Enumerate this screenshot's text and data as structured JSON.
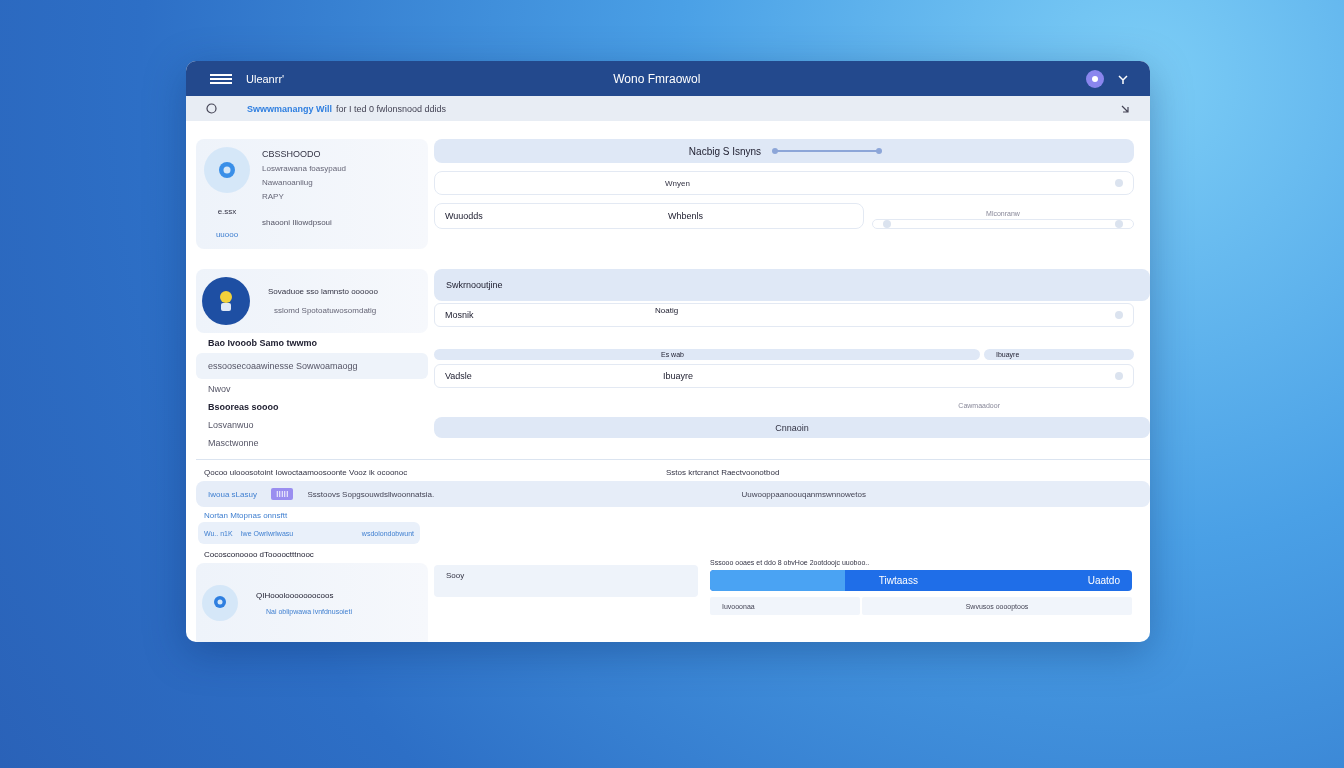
{
  "titlebar": {
    "app_label": "Uleanrr'",
    "title": "Wono Fmraowol"
  },
  "breadcrumb": {
    "link": "Swwwmanangy Will",
    "text": "for I ted 0 fwlonsnood ddids"
  },
  "profile": {
    "name": "CBSSHOODO",
    "lines": [
      "Loswrawana foasypaud",
      "Nawanoaniiug",
      "RAPY"
    ],
    "side_labels": [
      "e.ssx",
      "uuooo"
    ],
    "note": "shaooni Iliowdpsoui"
  },
  "settings": {
    "title": "Nacbig S Isnyns",
    "row_label": "Wnyen",
    "left_label": "Wuuodds",
    "left_value": "Whbenls",
    "right_caption": "Mlconranw",
    "level": 1
  },
  "account": {
    "title": "Swkrnooutjine",
    "subtitle": "Sovaduoe sso lamnsto oooooo",
    "line": "sslomd Spotoatuwosomdatig",
    "field_label": "Mosnik",
    "field_value": "Noatig"
  },
  "menu": [
    {
      "label": "Bao Ivooob Samo twwmo",
      "kind": "heading",
      "selected": false
    },
    {
      "label": "essoosecoaawinesse Sowwoamaogg",
      "kind": "plain",
      "selected": true
    },
    {
      "label": "Nwov",
      "kind": "plain",
      "selected": false
    },
    {
      "label": "Bsooreas soooo",
      "kind": "heading",
      "selected": false
    },
    {
      "label": "Losvanwuo",
      "kind": "plain",
      "selected": false
    },
    {
      "label": "Masctwonne",
      "kind": "plain",
      "selected": false
    }
  ],
  "table": {
    "columns": [
      "Es wab",
      "Ibuayre"
    ],
    "row": [
      "Vadsle",
      "Ibuayre"
    ],
    "caption": "Cawmaadoor",
    "footer": "Cnnaoin"
  },
  "summary": {
    "left_heading": "Qocoo ulooosotoint Iowoctaamoosoonte Vooz ik ocoonoc",
    "right_heading": "Sstos krtcranct Raectvoonotbod",
    "row_left": "Iwoua sLasuy",
    "tag": "IIIII",
    "row_mid": "Ssstoovs Sopgsouwdsllwoonnatsia.",
    "row_right": "Uuwooppaanoouqanmswnnowetos"
  },
  "notice": {
    "title": "Nortan Mtopnas onnsftt",
    "items": [
      "Wu.. n1K",
      "Iwe Owrlwrlwasu",
      "wsdolondobwunt"
    ]
  },
  "footer_heading": "Cocosconoooo dTooooctttnooc",
  "contact": {
    "name": "QIHooolooooooocoos",
    "line": "Nai oblipwawa ivnfdnusoieti",
    "field": "Sooy"
  },
  "progress": {
    "caption": "Sssooo ooaes et ddo 8 obvHoe 2ootdoojc uuoboo..",
    "level": 0.32,
    "label": "Tiwtaass",
    "end_label": "Uaatdo",
    "bottom": [
      "Iuvooonaa",
      "Swvusos ooooptoos"
    ]
  }
}
